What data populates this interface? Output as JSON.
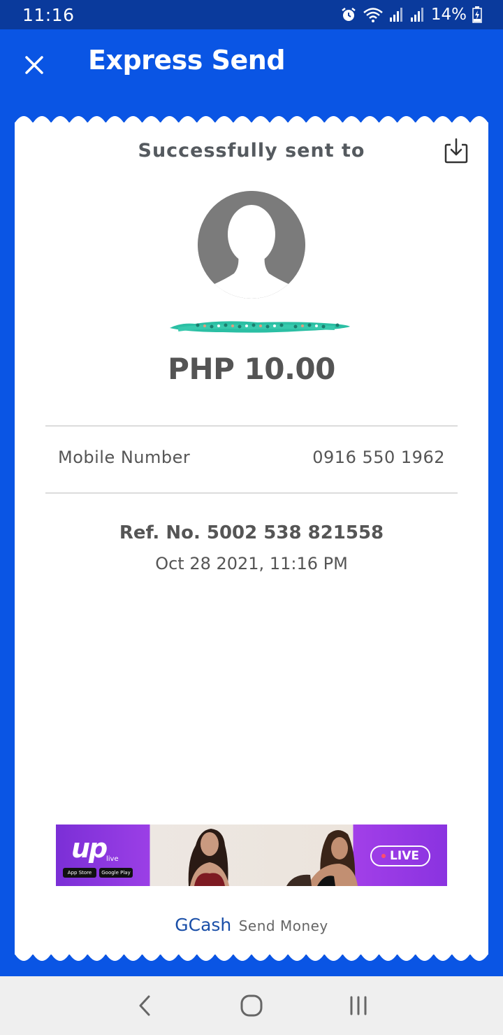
{
  "status_bar": {
    "time": "11:16",
    "battery": "14%",
    "icons": [
      "alarm-icon",
      "wifi-icon",
      "signal-icon",
      "signal-icon",
      "battery-charging-icon"
    ]
  },
  "header": {
    "title": "Express Send",
    "close_icon": "close-icon"
  },
  "receipt": {
    "heading": "Successfully sent to",
    "download_icon": "download-icon",
    "avatar_icon": "avatar-placeholder-icon",
    "amount": "PHP 10.00",
    "details": [
      {
        "label": "Mobile Number",
        "value": "0916 550 1962"
      }
    ],
    "ref_no": "Ref. No. 5002 538 821558",
    "date": "Oct 28 2021, 11:16 PM"
  },
  "ad": {
    "brand": "up",
    "brand_sub": "live",
    "store_1": "App Store",
    "store_2": "Google Play",
    "cta": "LIVE"
  },
  "footer": {
    "brand": "GCash",
    "tagline": "Send Money"
  },
  "nav": {
    "back_icon": "back-icon",
    "home_icon": "home-icon",
    "recents_icon": "recents-icon"
  },
  "colors": {
    "primary_blue": "#0a55e4",
    "status_bar": "#0a3a9c",
    "text_gray": "#555555",
    "gcash_blue": "#1a4fa8",
    "redaction": "#2bbfa4"
  }
}
